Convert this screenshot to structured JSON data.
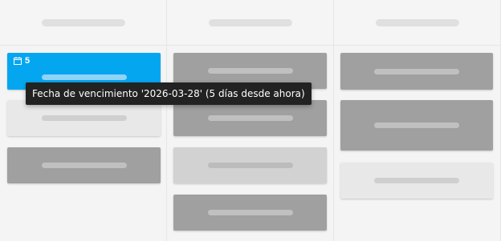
{
  "board": {
    "columns": [
      {
        "cards": [
          {
            "style": "blue",
            "due_count": "5",
            "icon": "calendar-icon"
          },
          {
            "style": "light"
          },
          {
            "style": "dark"
          }
        ]
      },
      {
        "cards": [
          {
            "style": "dark"
          },
          {
            "style": "dark"
          },
          {
            "style": "mid"
          },
          {
            "style": "dark"
          }
        ]
      },
      {
        "cards": [
          {
            "style": "dark"
          },
          {
            "style": "dark"
          },
          {
            "style": "light"
          }
        ]
      }
    ]
  },
  "tooltip": {
    "text": "Fecha de vencimiento '2026-03-28' (5 días desde ahora)"
  },
  "colors": {
    "accent": "#05a6f0",
    "card_dark": "#a0a0a0",
    "card_mid": "#d2d2d2",
    "card_light": "#e8e8e8",
    "tooltip_bg": "#222222"
  }
}
